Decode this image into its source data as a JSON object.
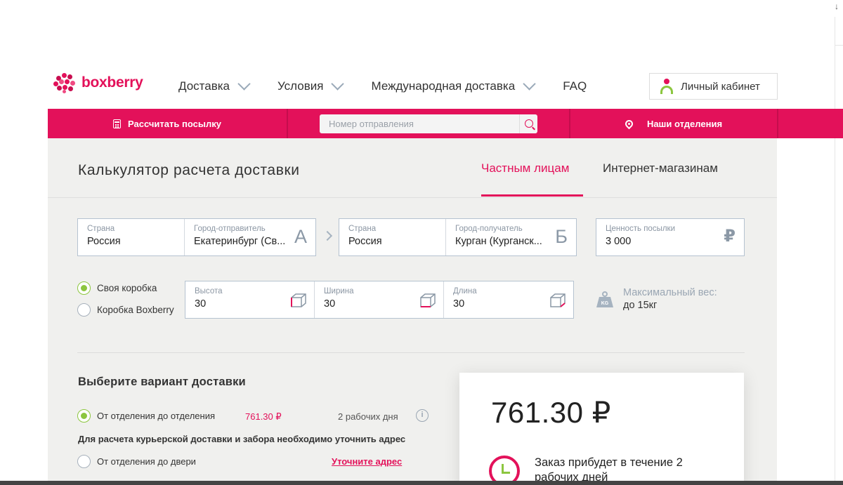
{
  "header": {
    "logo_text": "boxberry",
    "nav": [
      {
        "label": "Доставка",
        "has_dropdown": true
      },
      {
        "label": "Условия",
        "has_dropdown": true
      },
      {
        "label": "Международная доставка",
        "has_dropdown": true
      },
      {
        "label": "FAQ",
        "has_dropdown": false
      }
    ],
    "cabinet_label": "Личный кабинет"
  },
  "redbar": {
    "calc_label": "Рассчитать посылку",
    "search_placeholder": "Номер отправления",
    "offices_label": "Наши отделения"
  },
  "calculator": {
    "title": "Калькулятор расчета доставки",
    "tabs": [
      {
        "label": "Частным лицам",
        "active": true
      },
      {
        "label": "Интернет-магазинам",
        "active": false
      }
    ],
    "from": {
      "country_label": "Страна",
      "country_value": "Россия",
      "city_label": "Город-отправитель",
      "city_value": "Екатеринбург (Св...",
      "point_letter": "А"
    },
    "to": {
      "country_label": "Страна",
      "country_value": "Россия",
      "city_label": "Город-получатель",
      "city_value": "Курган (Курганск...",
      "point_letter": "Б"
    },
    "value": {
      "label": "Ценность посылки",
      "amount": "3 000",
      "currency": "₽"
    },
    "box_options": [
      {
        "label": "Своя коробка",
        "selected": true
      },
      {
        "label": "Коробка Boxberry",
        "selected": false
      }
    ],
    "dimensions": [
      {
        "label": "Высота",
        "value": "30"
      },
      {
        "label": "Ширина",
        "value": "30"
      },
      {
        "label": "Длина",
        "value": "30"
      }
    ],
    "max_weight": {
      "label": "Максимальный вес:",
      "value": "до 15кг",
      "icon_text": "KG"
    }
  },
  "delivery": {
    "section_title": "Выберите вариант доставки",
    "options": [
      {
        "label": "От отделения до отделения",
        "price": "761.30 ₽",
        "days": "2 рабочих дня",
        "selected": true
      },
      {
        "label": "От отделения до двери",
        "selected": false
      }
    ],
    "courier_note": "Для расчета курьерской доставки и забора необходимо уточнить адрес",
    "address_link": "Уточните адрес"
  },
  "result": {
    "price": "761.30 ₽",
    "eta_text": "Заказ прибудет в течение 2 рабочих дней"
  },
  "colors": {
    "brand": "#e3115a",
    "accent_green": "#8cc63f",
    "panel_bg": "#f0f0ee",
    "field_border": "#b5c2d0"
  }
}
